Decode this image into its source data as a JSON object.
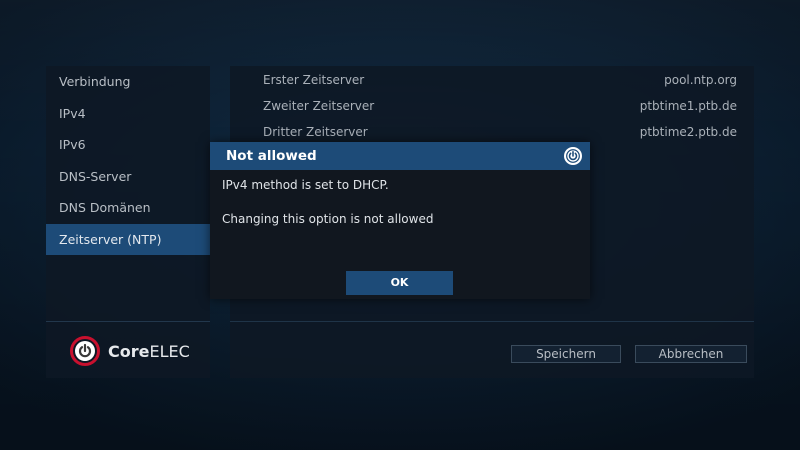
{
  "sidebar": {
    "items": [
      {
        "label": "Verbindung",
        "active": false
      },
      {
        "label": "IPv4",
        "active": false
      },
      {
        "label": "IPv6",
        "active": false
      },
      {
        "label": "DNS-Server",
        "active": false
      },
      {
        "label": "DNS Domänen",
        "active": false
      },
      {
        "label": "Zeitserver (NTP)",
        "active": true
      }
    ],
    "logo": {
      "brand_bold": "Core",
      "brand_rest": "ELEC"
    }
  },
  "settings": {
    "rows": [
      {
        "label": "Erster Zeitserver",
        "value": "pool.ntp.org"
      },
      {
        "label": "Zweiter Zeitserver",
        "value": "ptbtime1.ptb.de"
      },
      {
        "label": "Dritter Zeitserver",
        "value": "ptbtime2.ptb.de"
      }
    ]
  },
  "buttons": {
    "save_label": "Speichern",
    "cancel_label": "Abbrechen"
  },
  "dialog": {
    "title": "Not allowed",
    "message_line1": "IPv4 method is set to DHCP.",
    "message_line2": "Changing this option is not allowed",
    "ok_label": "OK"
  },
  "colors": {
    "accent": "#1d4b78",
    "brand_red": "#c8102e"
  },
  "icons": {
    "brand": "power-icon"
  }
}
